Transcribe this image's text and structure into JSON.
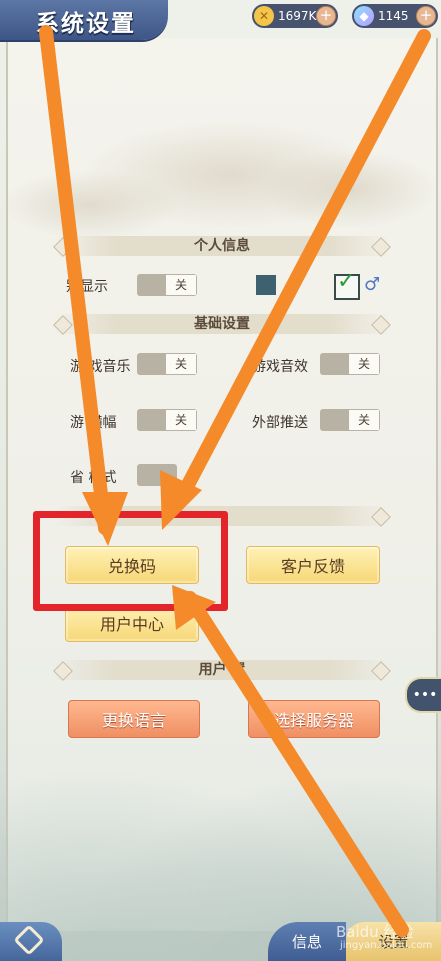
{
  "header": {
    "title": "系统设置",
    "resources": [
      {
        "icon": "gold-coin-icon",
        "value": "1697K",
        "plus": "+"
      },
      {
        "icon": "diamond-icon",
        "value": "1145",
        "plus": "+"
      }
    ]
  },
  "sections": {
    "personal": "个人信息",
    "basic": "基础设置",
    "user": "用户设置",
    "user_visible": "用户   置"
  },
  "rows": {
    "gender_label": "性别显示",
    "gender_label_visible": "  别显示",
    "music_label": "游戏音乐",
    "music_label_visible": "游 戏音乐",
    "sfx_label": "游戏音效",
    "banner_label": "游戏横幅",
    "banner_label_visible": "游   横幅",
    "push_label": "外部推送",
    "save_label": "省电模式",
    "save_label_visible": "省  模式",
    "off": "关"
  },
  "buttons": {
    "redeem": "兑换码",
    "feedback": "客户反馈",
    "user_center": "用户中心",
    "language": "更换语言",
    "server": "选择服务器"
  },
  "bottom": {
    "info": "信息",
    "settings": "设置"
  },
  "watermark": {
    "brand": "Baidu 经验",
    "url": "jingyan.baidu.com"
  },
  "colors": {
    "highlight": "#e4242b",
    "arrow": "#f58a2a",
    "accent_blue": "#45669a"
  }
}
